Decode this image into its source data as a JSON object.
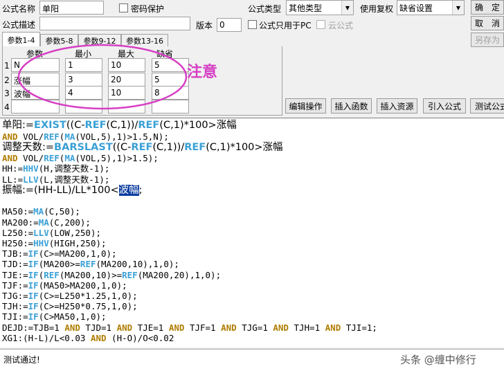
{
  "header": {
    "formula_name_label": "公式名称",
    "formula_name_value": "单阳",
    "password_label": "密码保护",
    "formula_type_label": "公式类型",
    "formula_type_value": "其他类型",
    "restore_label": "使用复权",
    "restore_value": "缺省设置",
    "ok_label": "确　定",
    "formula_desc_label": "公式描述",
    "formula_desc_value": "",
    "version_label": "版本",
    "version_value": "0",
    "pc_only_label": "公式只用于PC",
    "cloud_label": "云公式",
    "cancel_label": "取　消",
    "save_as_label": "另存为"
  },
  "tabs": [
    "参数1-4",
    "参数5-8",
    "参数9-12",
    "参数13-16"
  ],
  "params": {
    "headers": [
      "参数",
      "最小",
      "最大",
      "缺省"
    ],
    "rows": [
      {
        "num": "1",
        "name": "N",
        "min": "1",
        "max": "10",
        "default": "5"
      },
      {
        "num": "2",
        "name": "涨幅",
        "min": "3",
        "max": "20",
        "default": "5"
      },
      {
        "num": "3",
        "name": "波幅",
        "min": "4",
        "max": "10",
        "default": "8"
      },
      {
        "num": "4",
        "name": "",
        "min": "",
        "max": "",
        "default": ""
      }
    ]
  },
  "annotation": {
    "text": "注意",
    "color": "#d63fc4"
  },
  "actions": [
    "编辑操作",
    "插入函数",
    "插入资源",
    "引入公式",
    "测试公式"
  ],
  "code": {
    "l1a": "单阳:=",
    "l1b": "EXIST",
    "l1c": "((C-",
    "l1d": "REF",
    "l1e": "(C,1))/",
    "l1f": "REF",
    "l1g": "(C,1)*100>涨幅",
    "l2a": "AND",
    "l2b": " VOL/",
    "l2c": "REF",
    "l2d": "(",
    "l2e": "MA",
    "l2f": "(VOL,5),1)>1.5,N);",
    "l3a": "调整天数:=",
    "l3b": "BARSLAST",
    "l3c": "((C-",
    "l3d": "REF",
    "l3e": "(C,1))/",
    "l3f": "REF",
    "l3g": "(C,1)*100>涨幅",
    "l4a": "AND",
    "l4b": " VOL/",
    "l4c": "REF",
    "l4d": "(",
    "l4e": "MA",
    "l4f": "(VOL,5),1)>1.5);",
    "l5a": "HH:=",
    "l5b": "HHV",
    "l5c": "(H,调整天数-1);",
    "l6a": "LL:=",
    "l6b": "LLV",
    "l6c": "(L,调整天数-1);",
    "l7a": "振幅:=(HH-LL)/LL*100<",
    "l7b": "波幅",
    "l7c": ";",
    "l8a": "MA50:=",
    "l8b": "MA",
    "l8c": "(C,50);",
    "l9a": "MA200:=",
    "l9b": "MA",
    "l9c": "(C,200);",
    "l10a": "L250:=",
    "l10b": "LLV",
    "l10c": "(LOW,250);",
    "l11a": "H250:=",
    "l11b": "HHV",
    "l11c": "(HIGH,250);",
    "l12a": "TJB:=",
    "l12b": "IF",
    "l12c": "(C>=MA200,1,0);",
    "l13a": "TJD:=",
    "l13b": "IF",
    "l13c": "(MA200>=",
    "l13d": "REF",
    "l13e": "(MA200,10),1,0);",
    "l14a": "TJE:=",
    "l14b": "IF",
    "l14c": "(",
    "l14d": "REF",
    "l14e": "(MA200,10)>=",
    "l14f": "REF",
    "l14g": "(MA200,20),1,0);",
    "l15a": "TJF:=",
    "l15b": "IF",
    "l15c": "(MA50>MA200,1,0);",
    "l16a": "TJG:=",
    "l16b": "IF",
    "l16c": "(C>=L250*1.25,1,0);",
    "l17a": "TJH:=",
    "l17b": "IF",
    "l17c": "(C>=H250*0.75,1,0);",
    "l18a": "TJI:=",
    "l18b": "IF",
    "l18c": "(C>MA50,1,0);",
    "l19a": "DEJD:=TJB=1 ",
    "l19b": "AND",
    "l19c": " TJD=1 ",
    "l19d": "AND",
    "l19e": " TJE=1 ",
    "l19f": "AND",
    "l19g": " TJF=1 ",
    "l19h": "AND",
    "l19i": " TJG=1 ",
    "l19j": "AND",
    "l19k": " TJH=1 ",
    "l19l": "AND",
    "l19m": " TJI=1;",
    "l20a": "XG1:(H-L)/L<0.03 ",
    "l20b": "AND",
    "l20c": " (H-O)/O<0.02"
  },
  "status": {
    "message": "测试通过!",
    "watermark": "头条 @缠中修行"
  },
  "colors": {
    "keyword": "#b07d00",
    "function": "#3aa0d6",
    "annotation": "#d63fc4",
    "selection": "#0a3ca0"
  }
}
